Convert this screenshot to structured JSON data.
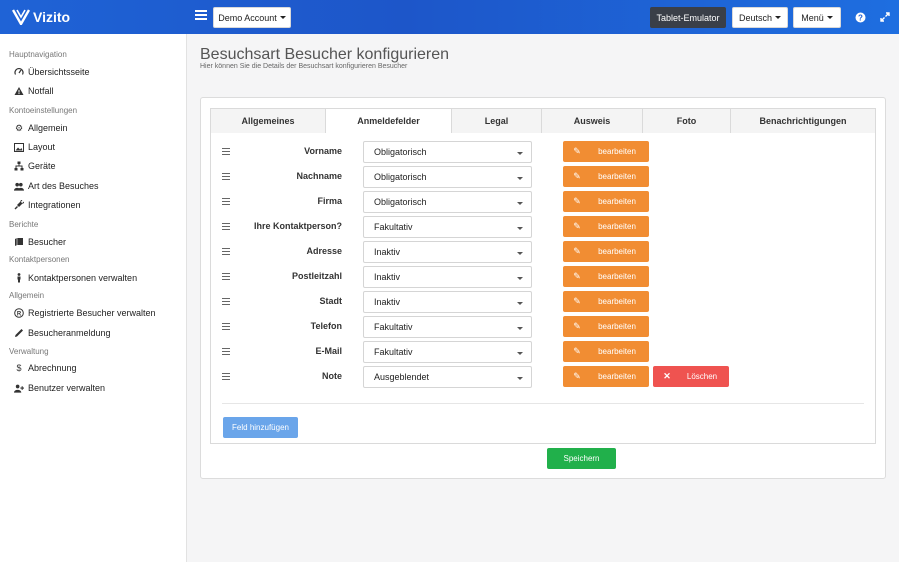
{
  "app": {
    "logo_text": "Vizito"
  },
  "header": {
    "account_label": "Demo Account",
    "tablet_label": "Tablet-Emulator",
    "language_label": "Deutsch",
    "menu_label": "Menü"
  },
  "sidebar": {
    "sections": [
      "Hauptnavigation",
      "Kontoeinstellungen",
      "Berichte",
      "Kontaktpersonen",
      "Allgemein",
      "Verwaltung"
    ],
    "items": [
      {
        "label": "Übersichtsseite",
        "icon": "dashboard-icon"
      },
      {
        "label": "Notfall",
        "icon": "warning-icon"
      },
      {
        "label": "Allgemein",
        "icon": "gear-icon"
      },
      {
        "label": "Layout",
        "icon": "image-icon"
      },
      {
        "label": "Geräte",
        "icon": "sitemap-icon"
      },
      {
        "label": "Art des Besuches",
        "icon": "users-icon"
      },
      {
        "label": "Integrationen",
        "icon": "plug-icon"
      },
      {
        "label": "Besucher",
        "icon": "book-icon"
      },
      {
        "label": "Kontaktpersonen verwalten",
        "icon": "person-icon"
      },
      {
        "label": "Registrierte Besucher verwalten",
        "icon": "registered-icon"
      },
      {
        "label": "Besucheranmeldung",
        "icon": "pencil-icon"
      },
      {
        "label": "Abrechnung",
        "icon": "dollar-icon"
      },
      {
        "label": "Benutzer verwalten",
        "icon": "user-plus-icon"
      }
    ]
  },
  "page": {
    "title": "Besuchsart Besucher konfigurieren",
    "subtitle": "Hier können Sie die Details der Besuchsart konfigurieren Besucher"
  },
  "tabs": [
    "Allgemeines",
    "Anmeldefelder",
    "Legal",
    "Ausweis",
    "Foto",
    "Benachrichtigungen"
  ],
  "active_tab": "Anmeldefelder",
  "fields": [
    {
      "label": "Vorname",
      "value": "Obligatorisch"
    },
    {
      "label": "Nachname",
      "value": "Obligatorisch"
    },
    {
      "label": "Firma",
      "value": "Obligatorisch"
    },
    {
      "label": "Ihre Kontaktperson?",
      "value": "Fakultativ"
    },
    {
      "label": "Adresse",
      "value": "Inaktiv"
    },
    {
      "label": "Postleitzahl",
      "value": "Inaktiv"
    },
    {
      "label": "Stadt",
      "value": "Inaktiv"
    },
    {
      "label": "Telefon",
      "value": "Fakultativ"
    },
    {
      "label": "E-Mail",
      "value": "Fakultativ"
    },
    {
      "label": "Note",
      "value": "Ausgeblendet"
    }
  ],
  "buttons": {
    "edit": "bearbeiten",
    "delete": "Löschen",
    "add_field": "Feld hinzufügen",
    "save": "Speichern"
  },
  "colors": {
    "header": "#1f63d6",
    "edit": "#f18d33",
    "delete": "#ef5350",
    "add": "#6aa5ea",
    "save": "#21b04b"
  }
}
